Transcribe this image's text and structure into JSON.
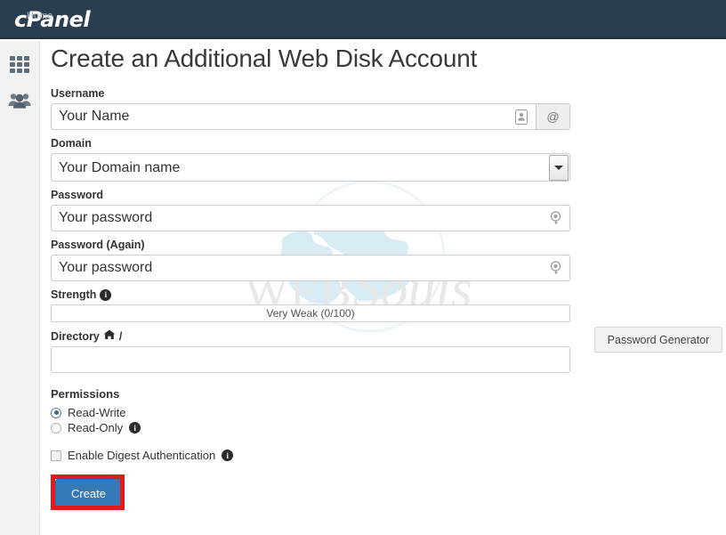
{
  "topbar": {
    "brand": "cPanel"
  },
  "sidebar": {
    "items": [
      {
        "icon": "apps-grid-icon",
        "label": "Home"
      },
      {
        "icon": "users-group-icon",
        "label": "User Manager"
      }
    ],
    "ghost_label": "Home"
  },
  "watermark": {
    "line1": "WEB",
    "line2": "Souls",
    "globe_color": "#d8ecf5"
  },
  "page": {
    "title": "Create an Additional Web Disk Account"
  },
  "form": {
    "username": {
      "label": "Username",
      "value": "Your Name",
      "placeholder": "Your Name",
      "field_icon": "contact-card-icon",
      "addon": "@"
    },
    "domain": {
      "label": "Domain",
      "value": "Your Domain name",
      "arrow_icon": "chevron-down-icon"
    },
    "password": {
      "label": "Password",
      "value": "Your password",
      "placeholder": "Your password",
      "field_icon": "password-key-icon"
    },
    "password_again": {
      "label": "Password (Again)",
      "value": "Your password",
      "placeholder": "Your password",
      "field_icon": "password-key-icon"
    },
    "strength": {
      "label": "Strength",
      "info_glyph": "i",
      "value_text": "Very Weak (0/100)",
      "score": 0,
      "max": 100
    },
    "directory": {
      "label": "Directory",
      "home_icon": "home-icon",
      "slash": "/",
      "value": "",
      "placeholder": ""
    },
    "permissions": {
      "heading": "Permissions",
      "options": [
        {
          "label": "Read-Write",
          "selected": true,
          "info": false
        },
        {
          "label": "Read-Only",
          "selected": false,
          "info": true
        }
      ],
      "digest": {
        "label": "Enable Digest Authentication",
        "checked": false,
        "info_glyph": "i"
      }
    },
    "create_button": {
      "label": "Create",
      "color": "#337ab7",
      "highlight_color": "#e01b1b"
    }
  },
  "password_generator": {
    "label": "Password Generator"
  }
}
